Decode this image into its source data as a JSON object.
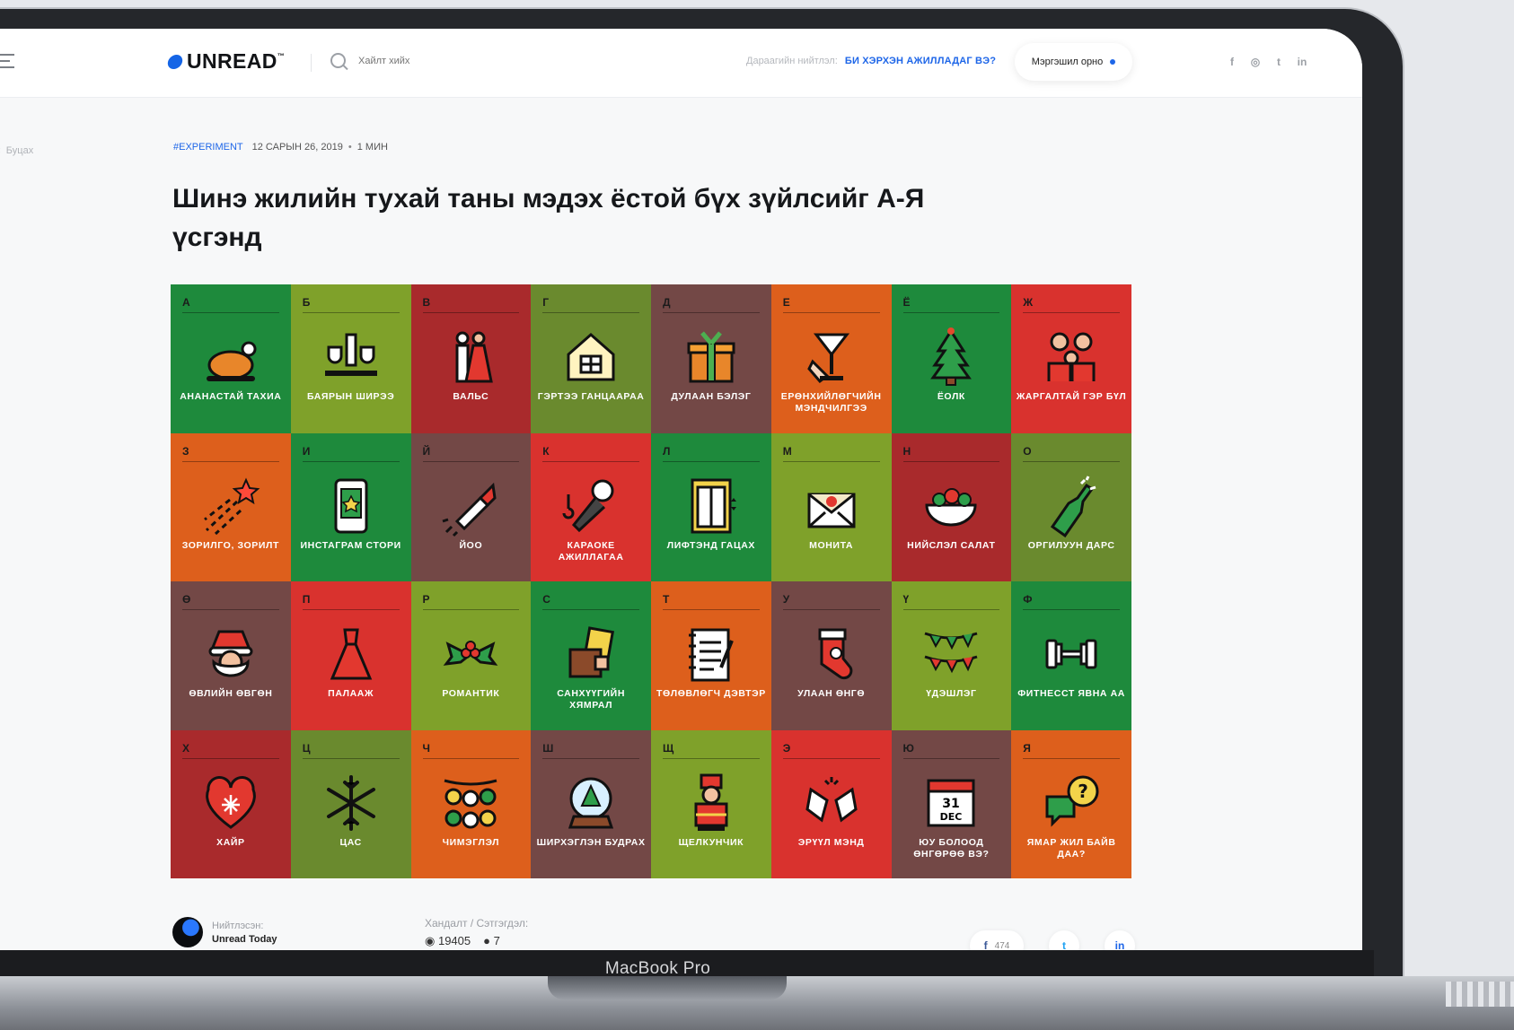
{
  "header": {
    "logo": "UNREAD",
    "logo_tm": "™",
    "search_placeholder": "Хайлт хийх",
    "next_post_caption": "Дараагийн нийтлэл:",
    "next_post_title": "БИ ХЭРХЭН АЖИЛЛАДАГ ВЭ?",
    "login": "Мэргэшил орно",
    "socials": [
      "f",
      "◎",
      "t",
      "in"
    ]
  },
  "back": "Буцах",
  "article": {
    "tag": "#EXPERIMENT",
    "date": "12 САРЫН 26, 2019",
    "read_time": "1 МИН",
    "title": "Шинэ жилийн тухай таны мэдэх ёстой бүх зүйлсийг А-Я үсгэнд"
  },
  "grid": [
    {
      "letter": "А",
      "label": "АНАНАСТАЙ ТАХИА",
      "color": "#1e8a3c",
      "icon": "roast-chicken-icon"
    },
    {
      "letter": "Б",
      "label": "БАЯРЫН ШИРЭЭ",
      "color": "#7fa12a",
      "icon": "festive-table-icon"
    },
    {
      "letter": "В",
      "label": "ВАЛЬС",
      "color": "#a92a2c",
      "icon": "waltz-couple-icon"
    },
    {
      "letter": "Г",
      "label": "ГЭРТЭЭ ГАНЦААРАА",
      "color": "#6a8a2e",
      "icon": "house-icon"
    },
    {
      "letter": "Д",
      "label": "ДУЛААН БЭЛЭГ",
      "color": "#734846",
      "icon": "gift-icon"
    },
    {
      "letter": "Е",
      "label": "ЕРӨНХИЙЛӨГЧИЙН МЭНДЧИЛГЭЭ",
      "color": "#dd5f1c",
      "icon": "toast-glass-icon"
    },
    {
      "letter": "Ё",
      "label": "ЁОЛК",
      "color": "#1e8a3c",
      "icon": "christmas-tree-icon"
    },
    {
      "letter": "Ж",
      "label": "ЖАРГАЛТАЙ ГЭР БҮЛ",
      "color": "#d9322e",
      "icon": "family-icon"
    },
    {
      "letter": "З",
      "label": "ЗОРИЛГО, ЗОРИЛТ",
      "color": "#dd5f1c",
      "icon": "shooting-star-icon"
    },
    {
      "letter": "И",
      "label": "ИНСТАГРАМ СТОРИ",
      "color": "#1e8a3c",
      "icon": "phone-story-icon"
    },
    {
      "letter": "Й",
      "label": "ЙОО",
      "color": "#734846",
      "icon": "firework-rocket-icon"
    },
    {
      "letter": "К",
      "label": "КАРАОКЕ АЖИЛЛАГАА",
      "color": "#d9322e",
      "icon": "microphone-icon"
    },
    {
      "letter": "Л",
      "label": "ЛИФТЭНД ГАЦАХ",
      "color": "#1e8a3c",
      "icon": "elevator-icon"
    },
    {
      "letter": "М",
      "label": "МОНИТА",
      "color": "#7fa12a",
      "icon": "envelope-icon"
    },
    {
      "letter": "Н",
      "label": "НИЙСЛЭЛ САЛАТ",
      "color": "#a92a2c",
      "icon": "salad-bowl-icon"
    },
    {
      "letter": "О",
      "label": "ОРГИЛУУН ДАРС",
      "color": "#6a8a2e",
      "icon": "champagne-bottle-icon"
    },
    {
      "letter": "Ө",
      "label": "ӨВЛИЙН ӨВГӨН",
      "color": "#734846",
      "icon": "santa-icon"
    },
    {
      "letter": "П",
      "label": "ПАЛААЖ",
      "color": "#d9322e",
      "icon": "dress-icon"
    },
    {
      "letter": "Р",
      "label": "РОМАНТИК",
      "color": "#7fa12a",
      "icon": "holly-icon"
    },
    {
      "letter": "С",
      "label": "САНХҮҮГИЙН ХЯМРАЛ",
      "color": "#1e8a3c",
      "icon": "money-wallet-icon"
    },
    {
      "letter": "Т",
      "label": "ТӨЛӨВЛӨГЧ ДЭВТЭР",
      "color": "#dd5f1c",
      "icon": "planner-notebook-icon"
    },
    {
      "letter": "У",
      "label": "УЛААН ӨНГӨ",
      "color": "#734846",
      "icon": "stocking-icon"
    },
    {
      "letter": "Ү",
      "label": "ҮДЭШЛЭГ",
      "color": "#7fa12a",
      "icon": "bunting-icon"
    },
    {
      "letter": "Ф",
      "label": "ФИТНЕССТ ЯВНА АА",
      "color": "#1e8a3c",
      "icon": "dumbbell-icon"
    },
    {
      "letter": "Х",
      "label": "ХАЙР",
      "color": "#a92a2c",
      "icon": "heart-icon"
    },
    {
      "letter": "Ц",
      "label": "ЦАС",
      "color": "#6a8a2e",
      "icon": "snowflake-icon"
    },
    {
      "letter": "Ч",
      "label": "ЧИМЭГЛЭЛ",
      "color": "#dd5f1c",
      "icon": "ornaments-icon"
    },
    {
      "letter": "Ш",
      "label": "ШИРХЭГЛЭН БУДРАХ",
      "color": "#734846",
      "icon": "snow-globe-icon"
    },
    {
      "letter": "Щ",
      "label": "ЩЕЛКУНЧИК",
      "color": "#7fa12a",
      "icon": "nutcracker-icon"
    },
    {
      "letter": "Э",
      "label": "ЭРҮҮЛ МЭНД",
      "color": "#d9322e",
      "icon": "clinking-hands-icon"
    },
    {
      "letter": "Ю",
      "label": "ЮУ БОЛООД ӨНГӨРӨӨ ВЭ?",
      "color": "#734846",
      "icon": "calendar-icon",
      "calendar_day": "31",
      "calendar_month": "DEC"
    },
    {
      "letter": "Я",
      "label": "ЯМАР ЖИЛ БАЙВ ДАА?",
      "color": "#dd5f1c",
      "icon": "question-bubble-icon"
    }
  ],
  "footer": {
    "author_caption": "Нийтлэсэн:",
    "author_name": "Unread Today",
    "stats_caption": "Хандалт / Сэтгэгдэл:",
    "views": "19405",
    "comments": "7",
    "fb_count": "474",
    "device_label": "MacBook Pro"
  }
}
